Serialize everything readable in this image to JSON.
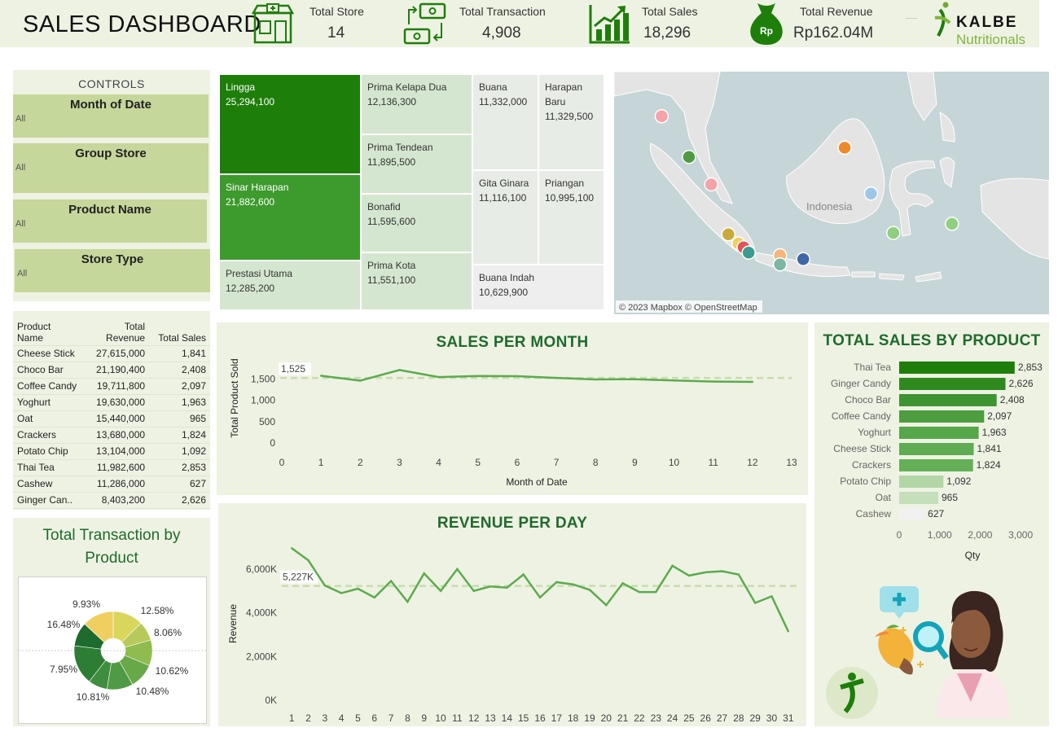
{
  "header": {
    "title": "SALES DASHBOARD",
    "kpis": [
      {
        "label": "Total Store",
        "value": "14",
        "icon": "store-icon"
      },
      {
        "label": "Total Transaction",
        "value": "4,908",
        "icon": "transaction-icon"
      },
      {
        "label": "Total Sales",
        "value": "18,296",
        "icon": "sales-growth-icon"
      },
      {
        "label": "Total Revenue",
        "value": "Rp162.04M",
        "icon": "money-bag-icon",
        "icon_text": "Rp"
      }
    ],
    "logo": {
      "line1": "KALBE",
      "line2": "Nutritionals"
    }
  },
  "controls": {
    "heading": "CONTROLS",
    "filters": [
      {
        "label": "Month of Date",
        "value": "All"
      },
      {
        "label": "Group Store",
        "value": "All"
      },
      {
        "label": "Product Name",
        "value": "All"
      },
      {
        "label": "Store Type",
        "value": "All"
      }
    ]
  },
  "product_table": {
    "headers": [
      "Product\nName",
      "Total\nRevenue",
      "Total Sales"
    ],
    "rows": [
      [
        "Cheese Stick",
        "27,615,000",
        "1,841"
      ],
      [
        "Choco Bar",
        "21,190,400",
        "2,408"
      ],
      [
        "Coffee Candy",
        "19,711,800",
        "2,097"
      ],
      [
        "Yoghurt",
        "19,630,000",
        "1,963"
      ],
      [
        "Oat",
        "15,440,000",
        "965"
      ],
      [
        "Crackers",
        "13,680,000",
        "1,824"
      ],
      [
        "Potato Chip",
        "13,104,000",
        "1,092"
      ],
      [
        "Thai Tea",
        "11,982,600",
        "2,853"
      ],
      [
        "Cashew",
        "11,286,000",
        "627"
      ],
      [
        "Ginger Can..",
        "8,403,200",
        "2,626"
      ]
    ]
  },
  "colors": {
    "dark_green": "#1e7e0a",
    "mid_green": "#3d9a2c",
    "pale_green": "#d5e6d0",
    "panel_bg": "#eef2e3",
    "line_green": "#5cab4d",
    "title_green": "#1f6b2c"
  },
  "map": {
    "country_label": "Indonesia",
    "attribution": "© 2023 Mapbox © OpenStreetMap"
  },
  "illustration": {
    "icons": [
      "plus-medical-icon",
      "magnifier-icon",
      "mango-icon",
      "kalbe-mini-logo-icon"
    ]
  },
  "chart_data": [
    {
      "type": "treemap",
      "items": [
        {
          "name": "Lingga",
          "value": 25294100,
          "label": "25,294,100"
        },
        {
          "name": "Sinar Harapan",
          "value": 21882600,
          "label": "21,882,600"
        },
        {
          "name": "Prestasi Utama",
          "value": 12285200,
          "label": "12,285,200"
        },
        {
          "name": "Prima Kelapa Dua",
          "value": 12136300,
          "label": "12,136,300"
        },
        {
          "name": "Prima Tendean",
          "value": 11895500,
          "label": "11,895,500"
        },
        {
          "name": "Bonafid",
          "value": 11595600,
          "label": "11,595,600"
        },
        {
          "name": "Prima Kota",
          "value": 11551100,
          "label": "11,551,100"
        },
        {
          "name": "Buana",
          "value": 11332000,
          "label": "11,332,000"
        },
        {
          "name": "Harapan Baru",
          "value": 11329500,
          "label": "11,329,500"
        },
        {
          "name": "Gita Ginara",
          "value": 11116100,
          "label": "11,116,100"
        },
        {
          "name": "Priangan",
          "value": 10995100,
          "label": "10,995,100"
        },
        {
          "name": "Buana Indah",
          "value": 10629900,
          "label": "10,629,900"
        }
      ]
    },
    {
      "type": "line",
      "title": "SALES PER MONTH",
      "xlabel": "Month of Date",
      "ylabel": "Total Product Sold",
      "x": [
        1,
        2,
        3,
        4,
        5,
        6,
        7,
        8,
        9,
        10,
        11,
        12
      ],
      "values": [
        1575,
        1460,
        1710,
        1545,
        1570,
        1565,
        1525,
        1490,
        1495,
        1465,
        1440,
        1432
      ],
      "reference_line": {
        "value": 1525,
        "label": "1,525"
      },
      "xlim": [
        0,
        13
      ],
      "ylim": [
        0,
        2100
      ],
      "yticks": [
        0,
        500,
        1000,
        1500
      ],
      "ytick_labels": [
        "0",
        "500",
        "1,000",
        "1,500"
      ]
    },
    {
      "type": "line",
      "title": "REVENUE PER DAY",
      "ylabel": "Revenue",
      "x": [
        1,
        2,
        3,
        4,
        5,
        6,
        7,
        8,
        9,
        10,
        11,
        12,
        13,
        14,
        15,
        16,
        17,
        18,
        19,
        20,
        21,
        22,
        23,
        24,
        25,
        26,
        27,
        28,
        29,
        30,
        31
      ],
      "values": [
        6950,
        6400,
        5250,
        4900,
        5100,
        4700,
        5450,
        4500,
        5800,
        5000,
        6000,
        5000,
        5200,
        5150,
        5750,
        4700,
        5400,
        5300,
        5050,
        4350,
        5350,
        4950,
        4950,
        6150,
        5700,
        5850,
        5900,
        5750,
        4450,
        4750,
        3150
      ],
      "reference_line": {
        "value": 5227,
        "label": "5,227K"
      },
      "ylim": [
        0,
        7000
      ],
      "yticks": [
        0,
        2000,
        4000,
        6000
      ],
      "ytick_labels": [
        "0K",
        "2,000K",
        "4,000K",
        "6,000K"
      ],
      "unit": "K"
    },
    {
      "type": "bar",
      "title": "TOTAL SALES BY PRODUCT",
      "orientation": "horizontal",
      "xlabel": "Qty",
      "categories": [
        "Thai Tea",
        "Ginger Candy",
        "Choco Bar",
        "Coffee Candy",
        "Yoghurt",
        "Cheese Stick",
        "Crackers",
        "Potato Chip",
        "Oat",
        "Cashew"
      ],
      "values": [
        2853,
        2626,
        2408,
        2097,
        1963,
        1841,
        1824,
        1092,
        965,
        627
      ],
      "labels": [
        "2,853",
        "2,626",
        "2,408",
        "2,097",
        "1,963",
        "1,841",
        "1,824",
        "1,092",
        "965",
        "627"
      ],
      "xlim": [
        0,
        3500
      ],
      "xticks": [
        0,
        1000,
        2000,
        3000
      ],
      "xtick_labels": [
        "0",
        "1,000",
        "2,000",
        "3,000"
      ]
    },
    {
      "type": "pie",
      "title": "Total Transaction by Product",
      "donut": true,
      "slices": [
        {
          "pct": 12.58,
          "label": "12.58%",
          "color": "#d9d65c"
        },
        {
          "pct": 8.06,
          "label": "8.06%",
          "color": "#b7c95a"
        },
        {
          "pct": 10.62,
          "label": "10.62%",
          "color": "#8fbb4f"
        },
        {
          "pct": 10.48,
          "label": "10.48%",
          "color": "#68a848"
        },
        {
          "pct": 10.81,
          "label": "10.81%",
          "color": "#4f9a44"
        },
        {
          "pct": 7.95,
          "label": "7.95%",
          "color": "#3f8d3e"
        },
        {
          "pct": 16.48,
          "label": "16.48%",
          "color": "#2d7d35"
        },
        {
          "pct": 9.93,
          "label": "9.93%",
          "color": "#1d6b2d"
        },
        {
          "pct": 13.09,
          "label": "",
          "color": "#f0cf60"
        }
      ]
    },
    {
      "type": "scatter",
      "title": "",
      "note": "store locations on map",
      "points": [
        {
          "lon": 98.7,
          "lat": 3.6,
          "color": "#f4a3a8"
        },
        {
          "lon": 101.4,
          "lat": 0.5,
          "color": "#4f9a44"
        },
        {
          "lon": 103.6,
          "lat": -1.6,
          "color": "#f4a3a8"
        },
        {
          "lon": 105.3,
          "lat": -5.4,
          "color": "#c9a93a"
        },
        {
          "lon": 106.3,
          "lat": -6.1,
          "color": "#f0cf60"
        },
        {
          "lon": 106.8,
          "lat": -6.4,
          "color": "#e0555a"
        },
        {
          "lon": 107.3,
          "lat": -6.8,
          "color": "#3c9b91"
        },
        {
          "lon": 110.4,
          "lat": -7.0,
          "color": "#f4b67a"
        },
        {
          "lon": 110.4,
          "lat": -7.7,
          "color": "#7ab8a4"
        },
        {
          "lon": 112.7,
          "lat": -7.3,
          "color": "#3f66a8"
        },
        {
          "lon": 116.8,
          "lat": 1.2,
          "color": "#ef8a2c"
        },
        {
          "lon": 119.4,
          "lat": -2.3,
          "color": "#9ec6ea"
        },
        {
          "lon": 121.6,
          "lat": -5.3,
          "color": "#8ed07f"
        },
        {
          "lon": 127.4,
          "lat": -4.6,
          "color": "#8ed07f"
        }
      ]
    }
  ]
}
